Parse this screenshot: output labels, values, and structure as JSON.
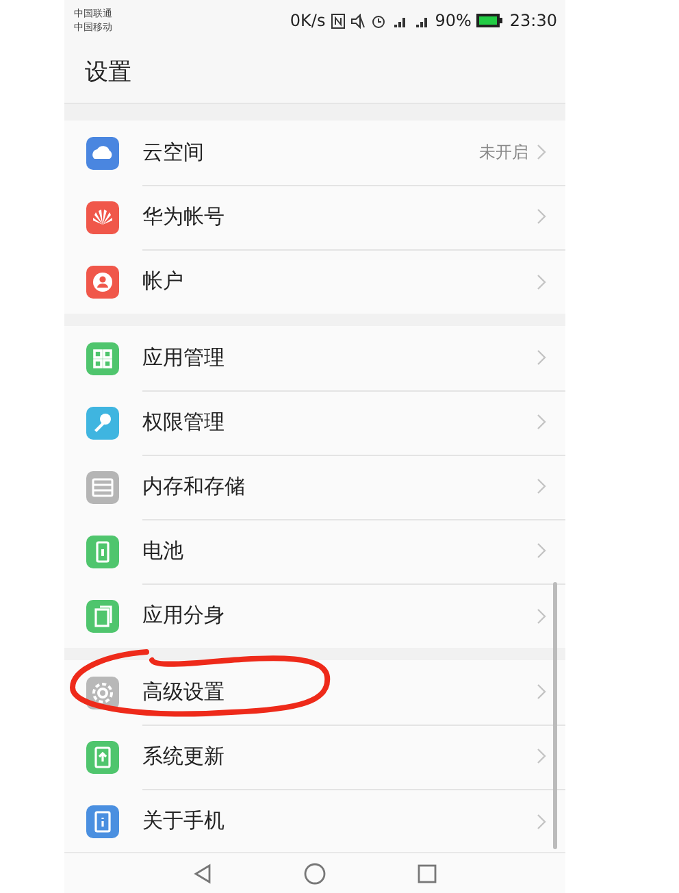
{
  "status_bar": {
    "carriers": [
      "中国联通",
      "中国移动"
    ],
    "speed": "0K/s",
    "battery": "90%",
    "time": "23:30"
  },
  "title": "设置",
  "groups": [
    {
      "items": [
        {
          "kind": "cloud",
          "label": "云空间",
          "value": "未开启",
          "highlighted": false
        },
        {
          "kind": "huawei",
          "label": "华为帐号",
          "highlighted": false
        },
        {
          "kind": "account",
          "label": "帐户",
          "highlighted": false
        }
      ]
    },
    {
      "items": [
        {
          "kind": "apps",
          "label": "应用管理",
          "highlighted": false
        },
        {
          "kind": "key",
          "label": "权限管理",
          "highlighted": false
        },
        {
          "kind": "storage",
          "label": "内存和存储",
          "highlighted": false
        },
        {
          "kind": "battery",
          "label": "电池",
          "highlighted": false
        },
        {
          "kind": "clone",
          "label": "应用分身",
          "highlighted": false
        }
      ]
    },
    {
      "items": [
        {
          "kind": "gear",
          "label": "高级设置",
          "highlighted": true
        },
        {
          "kind": "update",
          "label": "系统更新",
          "highlighted": false
        },
        {
          "kind": "info",
          "label": "关于手机",
          "highlighted": false
        }
      ]
    }
  ]
}
